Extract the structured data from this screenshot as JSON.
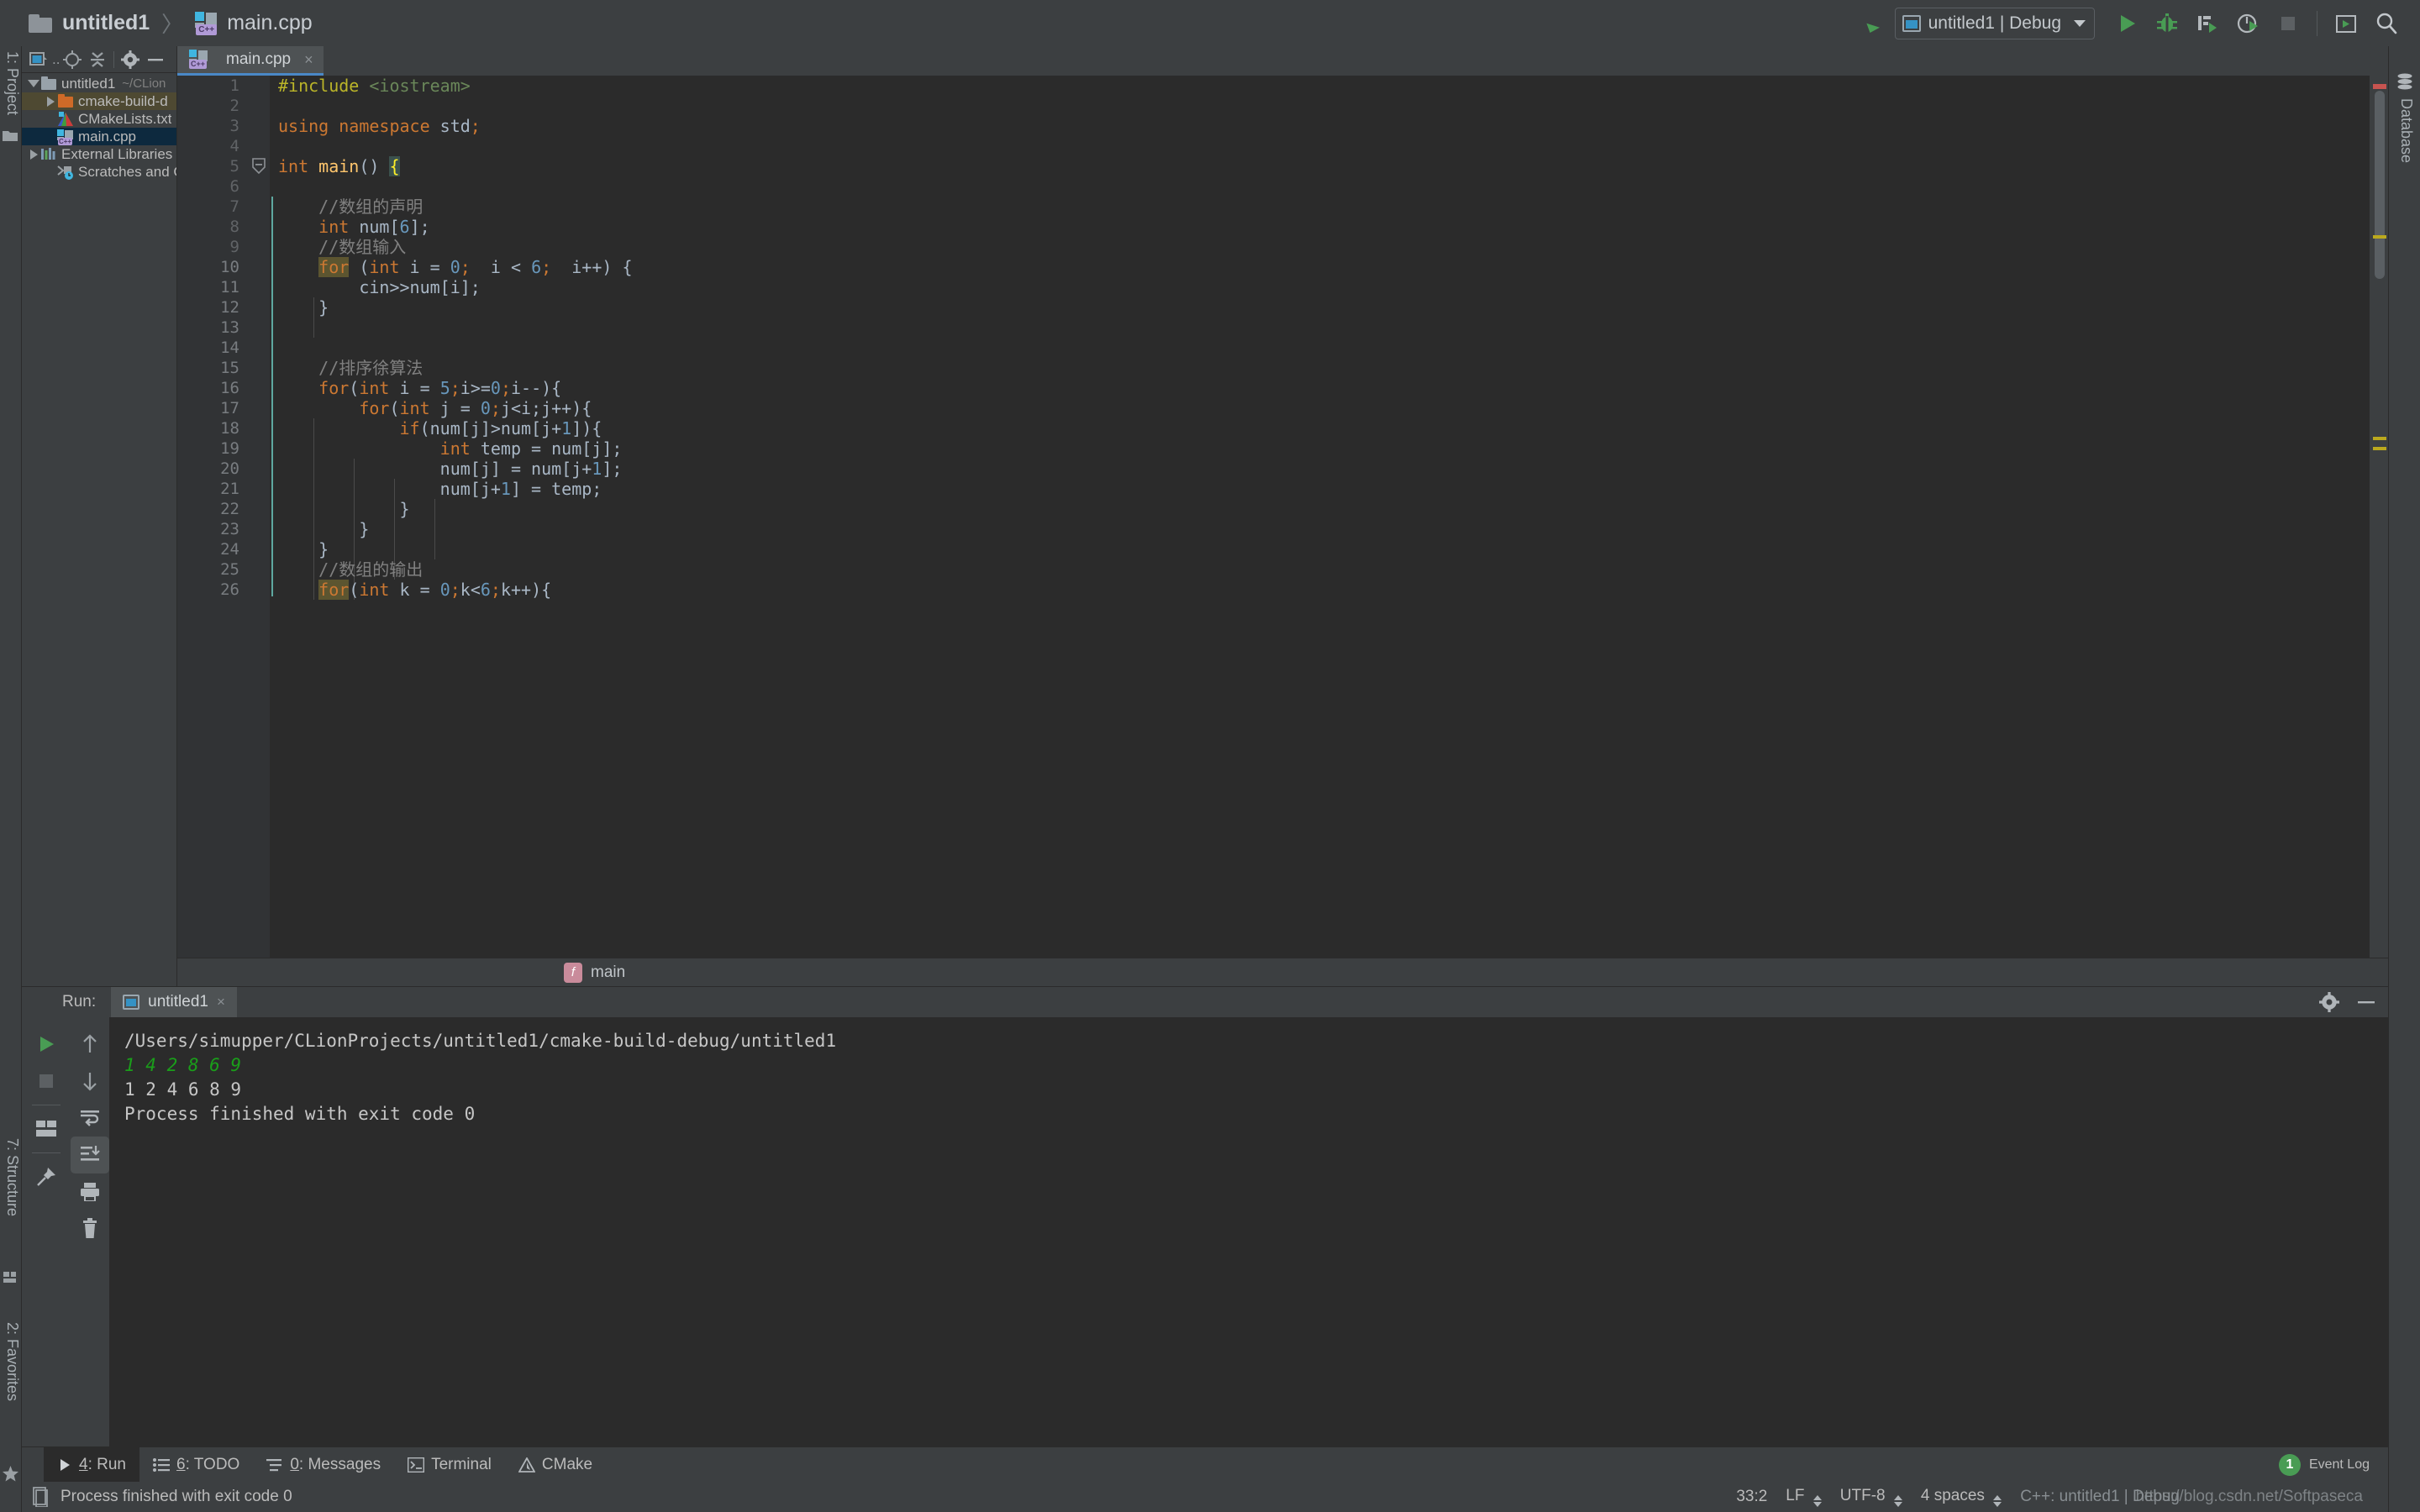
{
  "window": {
    "breadcrumb": {
      "project": "untitled1",
      "separator": "〉",
      "file": "main.cpp",
      "file_badge": "C++"
    },
    "run_configuration": {
      "label": "untitled1 | Debug"
    }
  },
  "toolbar_right": {
    "icons": [
      "update-project-icon",
      "run-icon",
      "debug-icon",
      "run-with-coverage-icon",
      "profile-icon",
      "stop-icon",
      "open-terminal-icon",
      "search-everywhere-icon"
    ]
  },
  "left_rail": {
    "project_label": "1: Project",
    "structure_label": "7: Structure",
    "favorites_label": "2: Favorites"
  },
  "right_rail": {
    "database_label": "Database"
  },
  "project_panel": {
    "toolbar_icons": [
      "project-scope-icon",
      "locate-icon",
      "collapse-all-icon",
      "settings-icon",
      "hide-icon"
    ],
    "tree": [
      {
        "label": "untitled1",
        "path": "~/CLion",
        "icon": "folder-icon",
        "twist": "down",
        "indent": 0,
        "state": "normal"
      },
      {
        "label": "cmake-build-d",
        "path": "",
        "icon": "folder-orange-icon",
        "twist": "right",
        "indent": 1,
        "state": "highlight"
      },
      {
        "label": "CMakeLists.txt",
        "path": "",
        "icon": "cmake-file-icon",
        "twist": "none",
        "indent": 1,
        "state": "normal"
      },
      {
        "label": "main.cpp",
        "path": "",
        "icon": "cpp-file-icon",
        "twist": "none",
        "indent": 1,
        "state": "selected"
      },
      {
        "label": "External Libraries",
        "path": "",
        "icon": "libraries-icon",
        "twist": "right",
        "indent": 0,
        "state": "normal"
      },
      {
        "label": "Scratches and Co",
        "path": "",
        "icon": "scratches-icon",
        "twist": "none",
        "indent": 0,
        "state": "normal"
      }
    ]
  },
  "editor": {
    "tab": {
      "label": "main.cpp",
      "badge": "C++",
      "close": "×"
    },
    "breadcrumb_bottom": {
      "badge": "f",
      "label": "main"
    },
    "first_line": 1,
    "lines": [
      {
        "n": 1,
        "tokens": [
          {
            "t": "#include ",
            "c": "prep"
          },
          {
            "t": "<iostream>",
            "c": "incl"
          }
        ]
      },
      {
        "n": 2,
        "tokens": []
      },
      {
        "n": 3,
        "tokens": [
          {
            "t": "using namespace ",
            "c": "kw"
          },
          {
            "t": "std",
            "c": "punc"
          },
          {
            "t": ";",
            "c": "kw"
          }
        ]
      },
      {
        "n": 4,
        "tokens": []
      },
      {
        "n": 5,
        "tokens": [
          {
            "t": "int ",
            "c": "kw"
          },
          {
            "t": "main",
            "c": "fn"
          },
          {
            "t": "()",
            "c": "punc"
          },
          {
            "t": " ",
            "c": "punc"
          },
          {
            "t": "{",
            "c": "brace-hl"
          }
        ],
        "gutter_run": true,
        "fold": true
      },
      {
        "n": 6,
        "tokens": []
      },
      {
        "n": 7,
        "tokens": [
          {
            "t": "    //数组的声明",
            "c": "cmt"
          }
        ]
      },
      {
        "n": 8,
        "tokens": [
          {
            "t": "    ",
            "c": "punc"
          },
          {
            "t": "int",
            "c": "kw"
          },
          {
            "t": " num[",
            "c": "punc"
          },
          {
            "t": "6",
            "c": "num"
          },
          {
            "t": "];",
            "c": "punc"
          }
        ]
      },
      {
        "n": 9,
        "tokens": [
          {
            "t": "    //数组输入",
            "c": "cmt"
          }
        ]
      },
      {
        "n": 10,
        "tokens": [
          {
            "t": "    ",
            "c": "punc"
          },
          {
            "t": "for",
            "c": "kw-hl"
          },
          {
            "t": " (",
            "c": "punc"
          },
          {
            "t": "int",
            "c": "kw"
          },
          {
            "t": " i = ",
            "c": "punc"
          },
          {
            "t": "0",
            "c": "num"
          },
          {
            "t": ";",
            "c": "kw"
          },
          {
            "t": "  i < ",
            "c": "punc"
          },
          {
            "t": "6",
            "c": "num"
          },
          {
            "t": ";",
            "c": "kw"
          },
          {
            "t": "  i++) {",
            "c": "punc"
          }
        ]
      },
      {
        "n": 11,
        "tokens": [
          {
            "t": "        cin>>num[i];",
            "c": "punc"
          }
        ]
      },
      {
        "n": 12,
        "tokens": [
          {
            "t": "    }",
            "c": "punc"
          }
        ]
      },
      {
        "n": 13,
        "tokens": []
      },
      {
        "n": 14,
        "tokens": []
      },
      {
        "n": 15,
        "tokens": [
          {
            "t": "    //排序徐算法",
            "c": "cmt"
          }
        ]
      },
      {
        "n": 16,
        "tokens": [
          {
            "t": "    ",
            "c": "punc"
          },
          {
            "t": "for",
            "c": "kw"
          },
          {
            "t": "(",
            "c": "punc"
          },
          {
            "t": "int",
            "c": "kw"
          },
          {
            "t": " i = ",
            "c": "punc"
          },
          {
            "t": "5",
            "c": "num"
          },
          {
            "t": ";",
            "c": "kw"
          },
          {
            "t": "i>=",
            "c": "punc"
          },
          {
            "t": "0",
            "c": "num"
          },
          {
            "t": ";",
            "c": "kw"
          },
          {
            "t": "i--){",
            "c": "punc"
          }
        ]
      },
      {
        "n": 17,
        "tokens": [
          {
            "t": "        ",
            "c": "punc"
          },
          {
            "t": "for",
            "c": "kw"
          },
          {
            "t": "(",
            "c": "punc"
          },
          {
            "t": "int",
            "c": "kw"
          },
          {
            "t": " j = ",
            "c": "punc"
          },
          {
            "t": "0",
            "c": "num"
          },
          {
            "t": ";",
            "c": "kw"
          },
          {
            "t": "j<i;j++){",
            "c": "punc"
          }
        ]
      },
      {
        "n": 18,
        "tokens": [
          {
            "t": "            ",
            "c": "punc"
          },
          {
            "t": "if",
            "c": "kw"
          },
          {
            "t": "(num[j]>num[j+",
            "c": "punc"
          },
          {
            "t": "1",
            "c": "num"
          },
          {
            "t": "]){",
            "c": "punc"
          }
        ]
      },
      {
        "n": 19,
        "tokens": [
          {
            "t": "                ",
            "c": "punc"
          },
          {
            "t": "int",
            "c": "kw"
          },
          {
            "t": " temp = num[j];",
            "c": "punc"
          }
        ]
      },
      {
        "n": 20,
        "tokens": [
          {
            "t": "                num[j] = num[j+",
            "c": "punc"
          },
          {
            "t": "1",
            "c": "num"
          },
          {
            "t": "];",
            "c": "punc"
          }
        ]
      },
      {
        "n": 21,
        "tokens": [
          {
            "t": "                num[j+",
            "c": "punc"
          },
          {
            "t": "1",
            "c": "num"
          },
          {
            "t": "] = temp;",
            "c": "punc"
          }
        ]
      },
      {
        "n": 22,
        "tokens": [
          {
            "t": "            }",
            "c": "punc"
          }
        ]
      },
      {
        "n": 23,
        "tokens": [
          {
            "t": "        }",
            "c": "punc"
          }
        ]
      },
      {
        "n": 24,
        "tokens": [
          {
            "t": "    }",
            "c": "punc"
          }
        ]
      },
      {
        "n": 25,
        "tokens": [
          {
            "t": "    //数组的输出",
            "c": "cmt"
          }
        ]
      },
      {
        "n": 26,
        "tokens": [
          {
            "t": "    ",
            "c": "punc"
          },
          {
            "t": "for",
            "c": "kw-hl"
          },
          {
            "t": "(",
            "c": "punc"
          },
          {
            "t": "int",
            "c": "kw"
          },
          {
            "t": " k = ",
            "c": "punc"
          },
          {
            "t": "0",
            "c": "num"
          },
          {
            "t": ";",
            "c": "kw"
          },
          {
            "t": "k<",
            "c": "punc"
          },
          {
            "t": "6",
            "c": "num"
          },
          {
            "t": ";",
            "c": "kw"
          },
          {
            "t": "k++){",
            "c": "punc"
          }
        ]
      }
    ]
  },
  "run_panel": {
    "label": "Run:",
    "tab": {
      "label": "untitled1",
      "close": "×"
    },
    "header_icons": [
      "settings-icon",
      "hide-icon"
    ],
    "tool_buttons_left": [
      "rerun-icon",
      "stop-icon",
      "layout-icon",
      "pin-icon"
    ],
    "tool_buttons_right": [
      "up-arrow-icon",
      "down-arrow-icon",
      "soft-wrap-icon",
      "scroll-to-end-icon",
      "print-icon",
      "clear-all-icon"
    ],
    "console": [
      {
        "text": "/Users/simupper/CLionProjects/untitled1/cmake-build-debug/untitled1",
        "style": "white"
      },
      {
        "text": "1 4 2 8 6 9",
        "style": "green"
      },
      {
        "text": "1  2  4  6  8  9",
        "style": "white"
      },
      {
        "text": "Process finished with exit code 0",
        "style": "white"
      }
    ]
  },
  "tool_window_bar": {
    "items": [
      {
        "key": "4",
        "label": ": Run",
        "icon": "run-icon",
        "active": true
      },
      {
        "key": "6",
        "label": ": TODO",
        "icon": "todo-icon",
        "active": false
      },
      {
        "key": "0",
        "label": ": Messages",
        "icon": "messages-icon",
        "active": false
      },
      {
        "key": "",
        "label": "Terminal",
        "icon": "terminal-icon",
        "active": false
      },
      {
        "key": "",
        "label": "CMake",
        "icon": "cmake-icon",
        "active": false
      }
    ],
    "event_log": {
      "count": "1",
      "label": "Event Log"
    }
  },
  "status_bar": {
    "message": "Process finished with exit code 0",
    "caret": "33:2",
    "line_separator": "LF",
    "encoding": "UTF-8",
    "indent": "4 spaces",
    "toolchain": "C++: untitled1 | Debug",
    "watermark": "https://blog.csdn.net/Softpaseca"
  },
  "colors": {
    "accent": "#4a88c7",
    "run_green": "#499c54",
    "keyword": "#cc7832",
    "number": "#6897bb",
    "comment": "#808080",
    "function": "#ffc66d",
    "preprocessor": "#bbb529",
    "editor_bg": "#2b2b2b",
    "panel_bg": "#3c3f41"
  }
}
